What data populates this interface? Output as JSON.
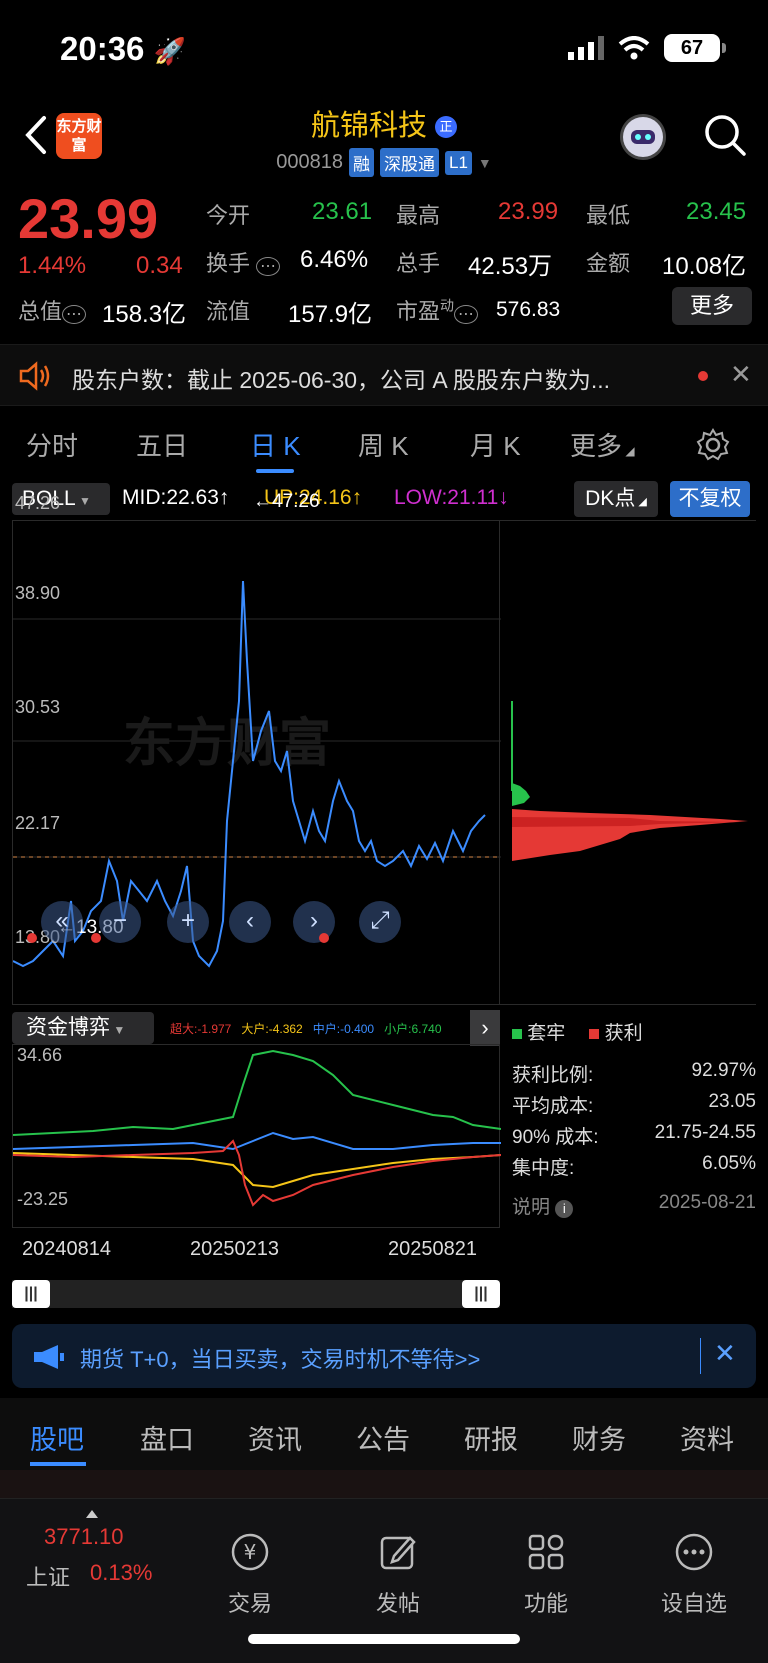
{
  "status": {
    "time": "20:36",
    "battery": "67"
  },
  "header": {
    "logo_text": "东方财富",
    "stock_name": "航锦科技",
    "stock_badge": "正",
    "stock_code": "000818",
    "tags": [
      "融",
      "深股通",
      "L1"
    ]
  },
  "quote": {
    "price": "23.99",
    "pct": "1.44%",
    "change": "0.34",
    "stats": [
      {
        "label": "今开",
        "value": "23.61",
        "color": "green"
      },
      {
        "label": "最高",
        "value": "23.99",
        "color": "red"
      },
      {
        "label": "最低",
        "value": "23.45",
        "color": "green"
      },
      {
        "label": "换手",
        "value": "6.46%",
        "color": "white"
      },
      {
        "label": "总手",
        "value": "42.53万",
        "color": "white"
      },
      {
        "label": "金额",
        "value": "10.08亿",
        "color": "white"
      },
      {
        "label": "总值",
        "value": "158.3亿",
        "color": "white"
      },
      {
        "label": "流值",
        "value": "157.9亿",
        "color": "white"
      },
      {
        "label": "市盈",
        "value": "576.83",
        "color": "white"
      }
    ],
    "pe_sup": "动",
    "more_label": "更多"
  },
  "notice": {
    "text": "股东户数：截止 2025-06-30，公司 A 股股东户数为..."
  },
  "period_tabs": [
    "分时",
    "五日",
    "日 K",
    "周 K",
    "月 K",
    "更多"
  ],
  "indicator": {
    "name": "BOLL",
    "mid": "MID:22.63",
    "up": "UP:24.16",
    "low": "LOW:21.11",
    "dk_label": "DK点",
    "fq_label": "不复权"
  },
  "main_chart": {
    "y_labels": [
      "47.26",
      "38.90",
      "30.53",
      "22.17",
      "13.80"
    ],
    "max_marker": "←47.26",
    "min_marker": "←13.80",
    "watermark": "东方财富"
  },
  "fund_panel": {
    "name": "资金博弈",
    "legend": [
      {
        "label": "超大:-1.977",
        "color": "#e53935"
      },
      {
        "label": "大户:-4.362",
        "color": "#f5c518"
      },
      {
        "label": "中户:-0.400",
        "color": "#3b8cff"
      },
      {
        "label": "小户:6.740",
        "color": "#27c24c"
      }
    ],
    "y_top": "34.66",
    "y_bottom": "-23.25",
    "x_labels": [
      "20240814",
      "20250213",
      "20250821"
    ]
  },
  "dist_panel": {
    "legend_trapped": "套牢",
    "legend_profit": "获利",
    "rows": [
      {
        "label": "获利比例:",
        "value": "92.97%"
      },
      {
        "label": "平均成本:",
        "value": "23.05"
      },
      {
        "label": "90% 成本:",
        "value": "21.75-24.55"
      },
      {
        "label": "集中度:",
        "value": "6.05%"
      }
    ],
    "note_label": "说明",
    "date": "2025-08-21"
  },
  "ad": {
    "text": "期货 T+0，当日买卖，交易时机不等待>>"
  },
  "section_tabs": [
    "股吧",
    "盘口",
    "资讯",
    "公告",
    "研报",
    "财务",
    "资料"
  ],
  "bottom_nav": {
    "index_value": "3771.10",
    "index_name": "上证",
    "index_pct": "0.13%",
    "items": [
      {
        "label": "交易",
        "icon": "yen-icon"
      },
      {
        "label": "发帖",
        "icon": "edit-icon"
      },
      {
        "label": "功能",
        "icon": "grid-icon"
      },
      {
        "label": "设自选",
        "icon": "more-icon"
      }
    ]
  }
}
